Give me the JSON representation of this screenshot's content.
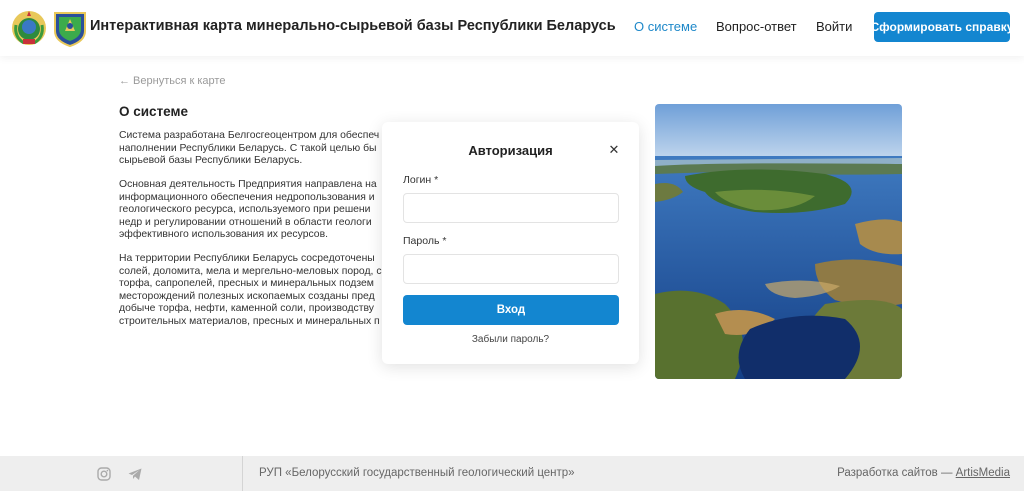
{
  "header": {
    "title": "Интерактивная карта минерально-сырьевой базы Республики Беларусь",
    "nav": [
      {
        "label": "О системе",
        "active": true
      },
      {
        "label": "Вопрос-ответ",
        "active": false
      },
      {
        "label": "Войти",
        "active": false
      }
    ],
    "cta_label": "Сформировать справку",
    "emblems": [
      "belarus-state-emblem-icon",
      "geological-center-emblem-icon"
    ]
  },
  "main": {
    "back_link": "← Вернуться к карте",
    "section_title": "О системе",
    "paragraphs": [
      [
        "Система разработана Белгосгеоцентром для обеспеч",
        "наполнении Республики Беларусь. С такой целью бы",
        "сырьевой базы Республики Беларусь."
      ],
      [
        "Основная деятельность Предприятия направлена на",
        "информационного обеспечения недропользования и",
        "геологического ресурса, используемого при решени",
        "недр и регулировании отношений в области геологи",
        "эффективного использования их ресурсов."
      ],
      [
        "На территории Республики Беларусь сосредоточены",
        "солей, доломита, мела и мергельно-меловых пород, с",
        "торфа, сапропелей, пресных и минеральных подзем",
        "месторождений полезных ископаемых созданы пред",
        "добыче торфа, нефти, каменной соли, производству",
        "строительных материалов, пресных и минеральных п"
      ]
    ]
  },
  "modal": {
    "title": "Авторизация",
    "close_icon": "close-icon",
    "login_label": "Логин *",
    "login_value": "",
    "password_label": "Пароль *",
    "password_value": "",
    "submit_label": "Вход",
    "forgot_label": "Забыли пароль?"
  },
  "footer": {
    "social_icons": [
      "instagram-icon",
      "telegram-icon"
    ],
    "org": "РУП «Белорусский государственный геологический центр»",
    "dev_prefix": "Разработка сайтов — ",
    "dev_link": "ArtisMedia"
  },
  "colors": {
    "accent": "#1386d0",
    "active_nav": "#1e88c9",
    "footer_bg": "#eeeeee"
  }
}
